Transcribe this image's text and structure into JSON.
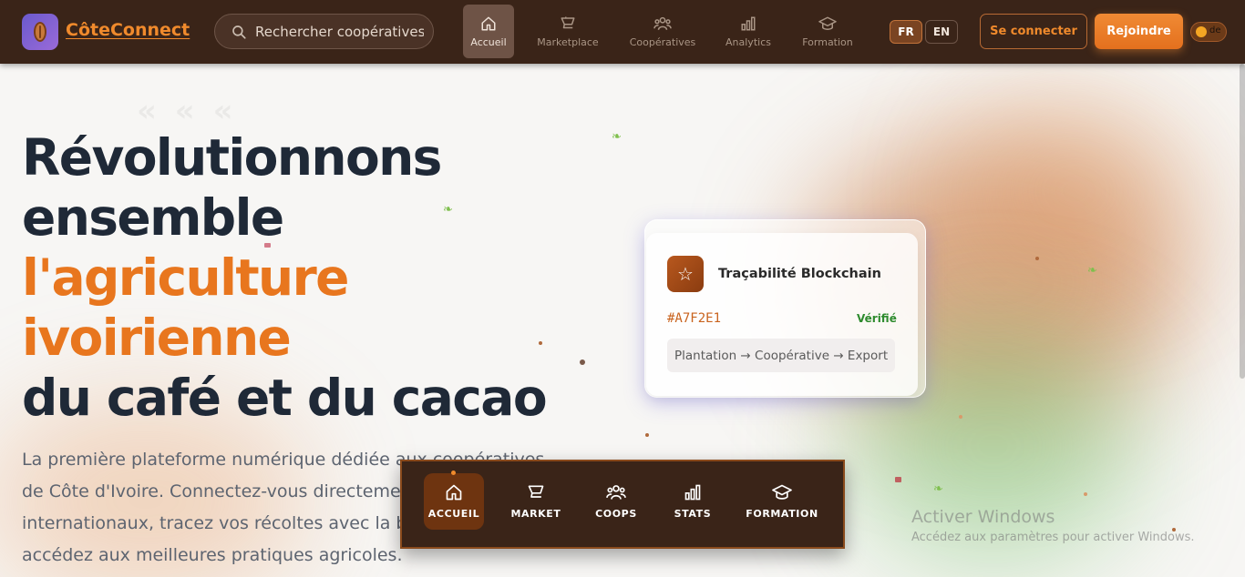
{
  "brand": {
    "name": "CôteConnect",
    "accent": "#f08a2c",
    "bar_bg": "#3a2418"
  },
  "search": {
    "placeholder": "Rechercher coopératives, produits..."
  },
  "nav": {
    "items": [
      {
        "label": "Accueil",
        "icon": "home-icon",
        "active": true
      },
      {
        "label": "Marketplace",
        "icon": "cart-icon"
      },
      {
        "label": "Coopératives",
        "icon": "users-icon"
      },
      {
        "label": "Analytics",
        "icon": "bar-chart-icon"
      },
      {
        "label": "Formation",
        "icon": "graduation-cap-icon"
      }
    ]
  },
  "lang": {
    "fr": "FR",
    "en": "EN",
    "selected": "FR"
  },
  "auth": {
    "login": "Se connecter",
    "join": "Rejoindre"
  },
  "theme_toggle": {
    "label": "de"
  },
  "hero": {
    "line1": "Révolutionnons",
    "line2": "ensemble",
    "line3": "l'agriculture",
    "line4": "ivoirienne",
    "line5": "du café et du cacao",
    "subtitle": "La première plateforme numérique dédiée aux coopératives de Côte d'Ivoire. Connectez-vous directement aux acheteurs internationaux, tracez vos récoltes avec la blockchain et accédez aux meilleures pratiques agricoles."
  },
  "card": {
    "icon": "star-icon",
    "title": "Traçabilité Blockchain",
    "hash": "#A7F2E1",
    "status": "Vérifié",
    "status_color": "#2e8b2e",
    "path": "Plantation → Coopérative → Export"
  },
  "dock": {
    "items": [
      {
        "label": "ACCUEIL",
        "icon": "home-icon",
        "active": true
      },
      {
        "label": "MARKET",
        "icon": "cart-icon"
      },
      {
        "label": "COOPS",
        "icon": "users-icon"
      },
      {
        "label": "STATS",
        "icon": "bar-chart-icon"
      },
      {
        "label": "FORMATION",
        "icon": "graduation-cap-icon"
      }
    ]
  },
  "watermark": {
    "title": "Activer Windows",
    "subtitle": "Accédez aux paramètres pour activer Windows."
  }
}
